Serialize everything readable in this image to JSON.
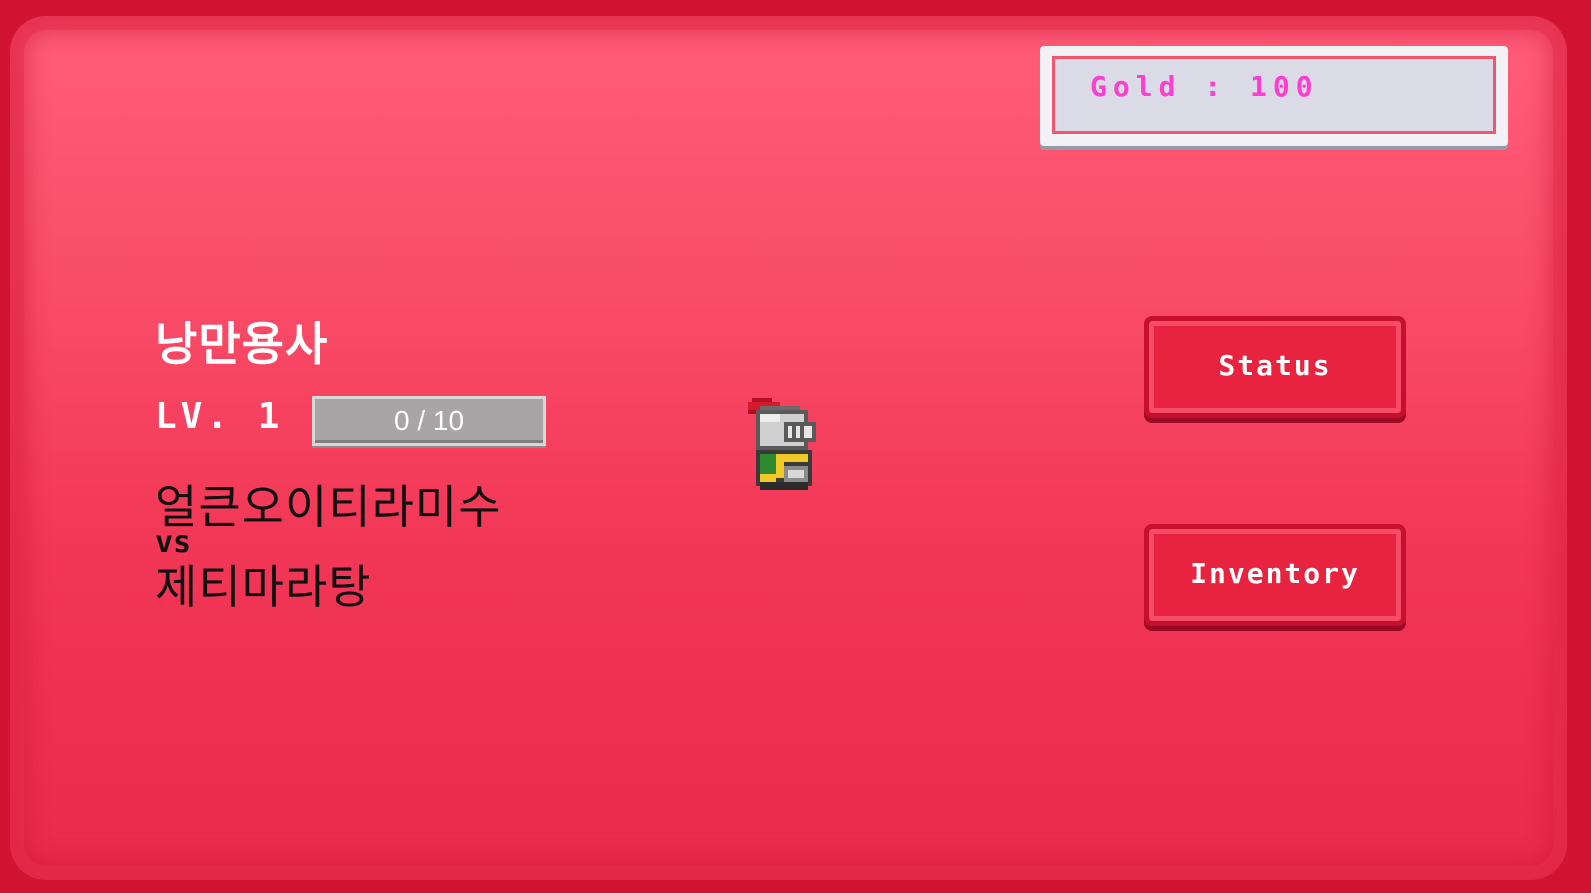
{
  "hud": {
    "gold_text": "Gold : 100",
    "gold_color": "#ff3ed0"
  },
  "hero": {
    "name": "낭만용사",
    "level_label": "LV. 1",
    "exp_text": "0 / 10",
    "exp_progress": 0.0,
    "sprite": "knight-sprite"
  },
  "matchup": {
    "line1": "얼큰오이티라미수",
    "vs": "vs",
    "line2": "제티마라탕"
  },
  "menu": {
    "status_label": "Status",
    "inventory_label": "Inventory"
  },
  "colors": {
    "panel": "#f23656",
    "button": "#e8233f",
    "exp_bar": "#a7a5a6"
  }
}
